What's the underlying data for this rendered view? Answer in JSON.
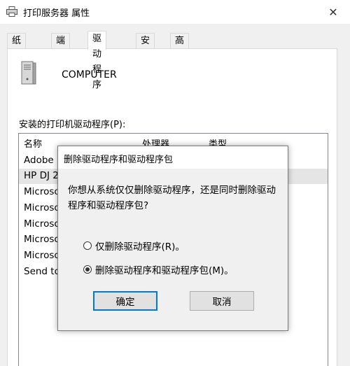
{
  "window": {
    "title": "打印服务器 属性",
    "close_glyph": "✕"
  },
  "tabs": [
    {
      "label": "纸张规格",
      "active": false
    },
    {
      "label": "端口",
      "active": false
    },
    {
      "label": "驱动程序",
      "active": true
    },
    {
      "label": "安全",
      "active": false
    },
    {
      "label": "高级",
      "active": false
    }
  ],
  "server": {
    "name": "COMPUTER",
    "icon": "server-icon"
  },
  "drivers_label": "安装的打印机驱动程序(P):",
  "list": {
    "columns": [
      "名称",
      "处理器",
      "类型"
    ],
    "rows": [
      {
        "name": "Adobe",
        "selected": false
      },
      {
        "name": "HP DJ 2",
        "selected": true
      },
      {
        "name": "Microso",
        "selected": false
      },
      {
        "name": "Microso",
        "selected": false
      },
      {
        "name": "Microso",
        "selected": false
      },
      {
        "name": "Microso",
        "selected": false
      },
      {
        "name": "Microso",
        "selected": false
      },
      {
        "name": "Send to",
        "selected": false
      }
    ]
  },
  "dialog": {
    "title": "删除驱动程序和驱动程序包",
    "message": "你想从系统仅仅删除驱动程序，还是同时删除驱动程序和驱动程序包?",
    "options": [
      {
        "label": "仅删除驱动程序(R)。",
        "checked": false
      },
      {
        "label": "删除驱动程序和驱动程序包(M)。",
        "checked": true
      }
    ],
    "ok_label": "确定",
    "cancel_label": "取消"
  },
  "colors": {
    "focus_border": "#0078d7",
    "selected_row": "#e5e5e5"
  }
}
